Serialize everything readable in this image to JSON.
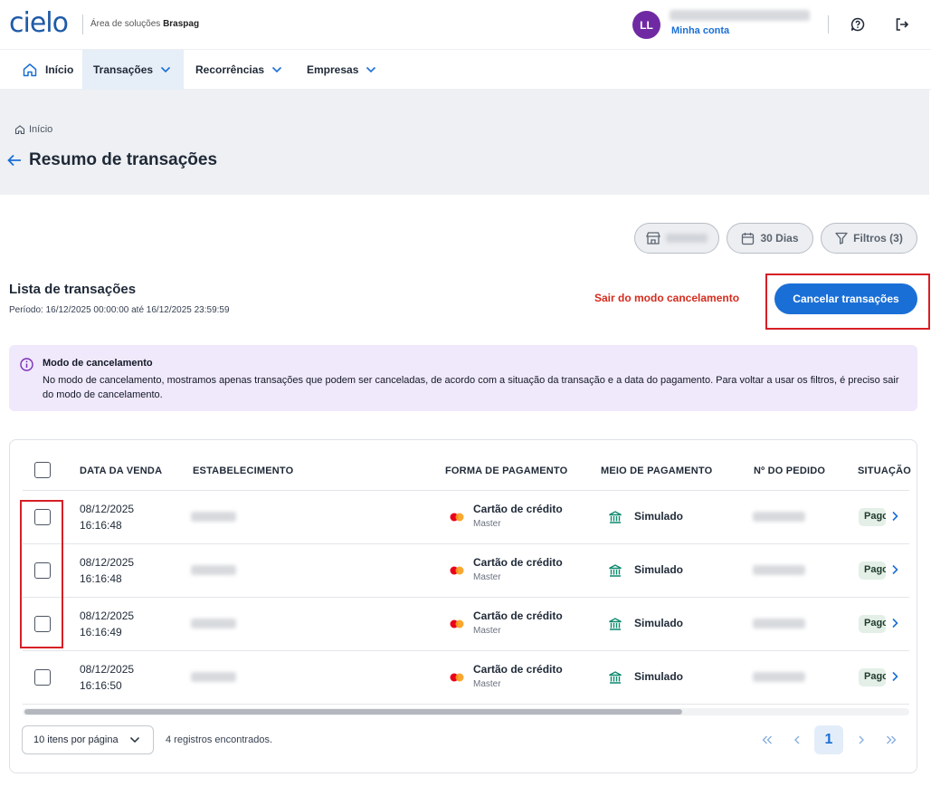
{
  "header": {
    "logo": "cielo",
    "subtitle_prefix": "Área de soluções",
    "subtitle_brand": "Braspag",
    "avatar_initials": "LL",
    "account_link": "Minha conta"
  },
  "nav": {
    "items": [
      {
        "label": "Início"
      },
      {
        "label": "Transações"
      },
      {
        "label": "Recorrências"
      },
      {
        "label": "Empresas"
      }
    ]
  },
  "breadcrumb": {
    "label": "Início"
  },
  "page": {
    "title": "Resumo de transações"
  },
  "filters": {
    "period_label": "30 Dias",
    "filters_label": "Filtros (3)"
  },
  "list": {
    "title": "Lista de transações",
    "period": "Período: 16/12/2025 00:00:00 até 16/12/2025 23:59:59",
    "exit_cancel_mode": "Sair do modo cancelamento",
    "cancel_button": "Cancelar transações"
  },
  "banner": {
    "title": "Modo de cancelamento",
    "text": "No modo de cancelamento, mostramos apenas transações que podem ser canceladas, de acordo com a situação da transação e a data do pagamento. Para voltar a usar os filtros, é preciso sair do modo de cancelamento."
  },
  "table": {
    "columns": [
      "DATA DA VENDA",
      "ESTABELECIMENTO",
      "FORMA DE PAGAMENTO",
      "MEIO DE PAGAMENTO",
      "Nº DO PEDIDO",
      "SITUAÇÃO"
    ],
    "rows": [
      {
        "date": "08/12/2025",
        "time": "16:16:48",
        "payment_form": "Cartão de crédito",
        "brand": "Master",
        "payment_method": "Simulado",
        "status": "Pago"
      },
      {
        "date": "08/12/2025",
        "time": "16:16:48",
        "payment_form": "Cartão de crédito",
        "brand": "Master",
        "payment_method": "Simulado",
        "status": "Pago"
      },
      {
        "date": "08/12/2025",
        "time": "16:16:49",
        "payment_form": "Cartão de crédito",
        "brand": "Master",
        "payment_method": "Simulado",
        "status": "Pago"
      },
      {
        "date": "08/12/2025",
        "time": "16:16:50",
        "payment_form": "Cartão de crédito",
        "brand": "Master",
        "payment_method": "Simulado",
        "status": "Pago"
      }
    ]
  },
  "pagination": {
    "per_page": "10 itens por página",
    "records": "4 registros encontrados.",
    "current_page": "1"
  },
  "colors": {
    "primary": "#1a6fd6",
    "danger": "#d52b1e",
    "avatar": "#6f2aa3",
    "banner_bg": "#f0e8fb",
    "highlight": "#d61f26"
  }
}
